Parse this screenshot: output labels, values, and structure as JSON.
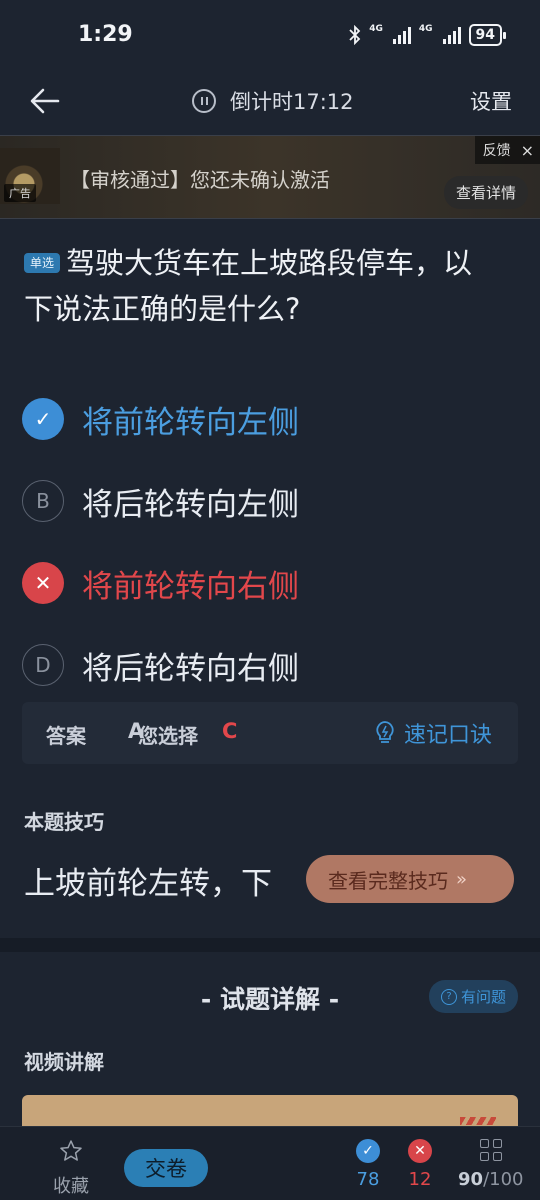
{
  "status_bar": {
    "time": "1:29",
    "network_1": "4G",
    "network_2": "4G",
    "battery": "94"
  },
  "nav": {
    "countdown": "倒计时17:12",
    "settings": "设置"
  },
  "ad": {
    "text": "【审核通过】您还未确认激活",
    "badge": "广告",
    "feedback": "反馈",
    "close": "×",
    "detail_button": "查看详情"
  },
  "question": {
    "type": "单选",
    "text": "驾驶大货车在上坡路段停车，以下说法正确的是什么?"
  },
  "options": [
    {
      "marker": "✓",
      "text": "将前轮转向左侧",
      "state": "correct"
    },
    {
      "marker": "B",
      "text": "将后轮转向左侧",
      "state": "plain"
    },
    {
      "marker": "✕",
      "text": "将前轮转向右侧",
      "state": "wrong"
    },
    {
      "marker": "D",
      "text": "将后轮转向右侧",
      "state": "plain"
    }
  ],
  "answer": {
    "answer_label": "答案",
    "answer_value": "A",
    "chosen_label": "您选择",
    "chosen_value": "C",
    "mnemonic": "速记口诀"
  },
  "tip": {
    "title": "本题技巧",
    "text": "上坡前轮左转，下",
    "button": "查看完整技巧"
  },
  "details": {
    "title": "- 试题详解 -",
    "ask_button": "有问题",
    "video_title": "视频讲解"
  },
  "bottom_bar": {
    "favorite": "收藏",
    "submit": "交卷",
    "correct_count": "78",
    "wrong_count": "12",
    "progress_current": "90",
    "progress_total": "/100"
  },
  "colors": {
    "background": "#1d2430",
    "correct": "#3d8ed6",
    "wrong": "#d8454a",
    "tip_button": "#b07864"
  }
}
